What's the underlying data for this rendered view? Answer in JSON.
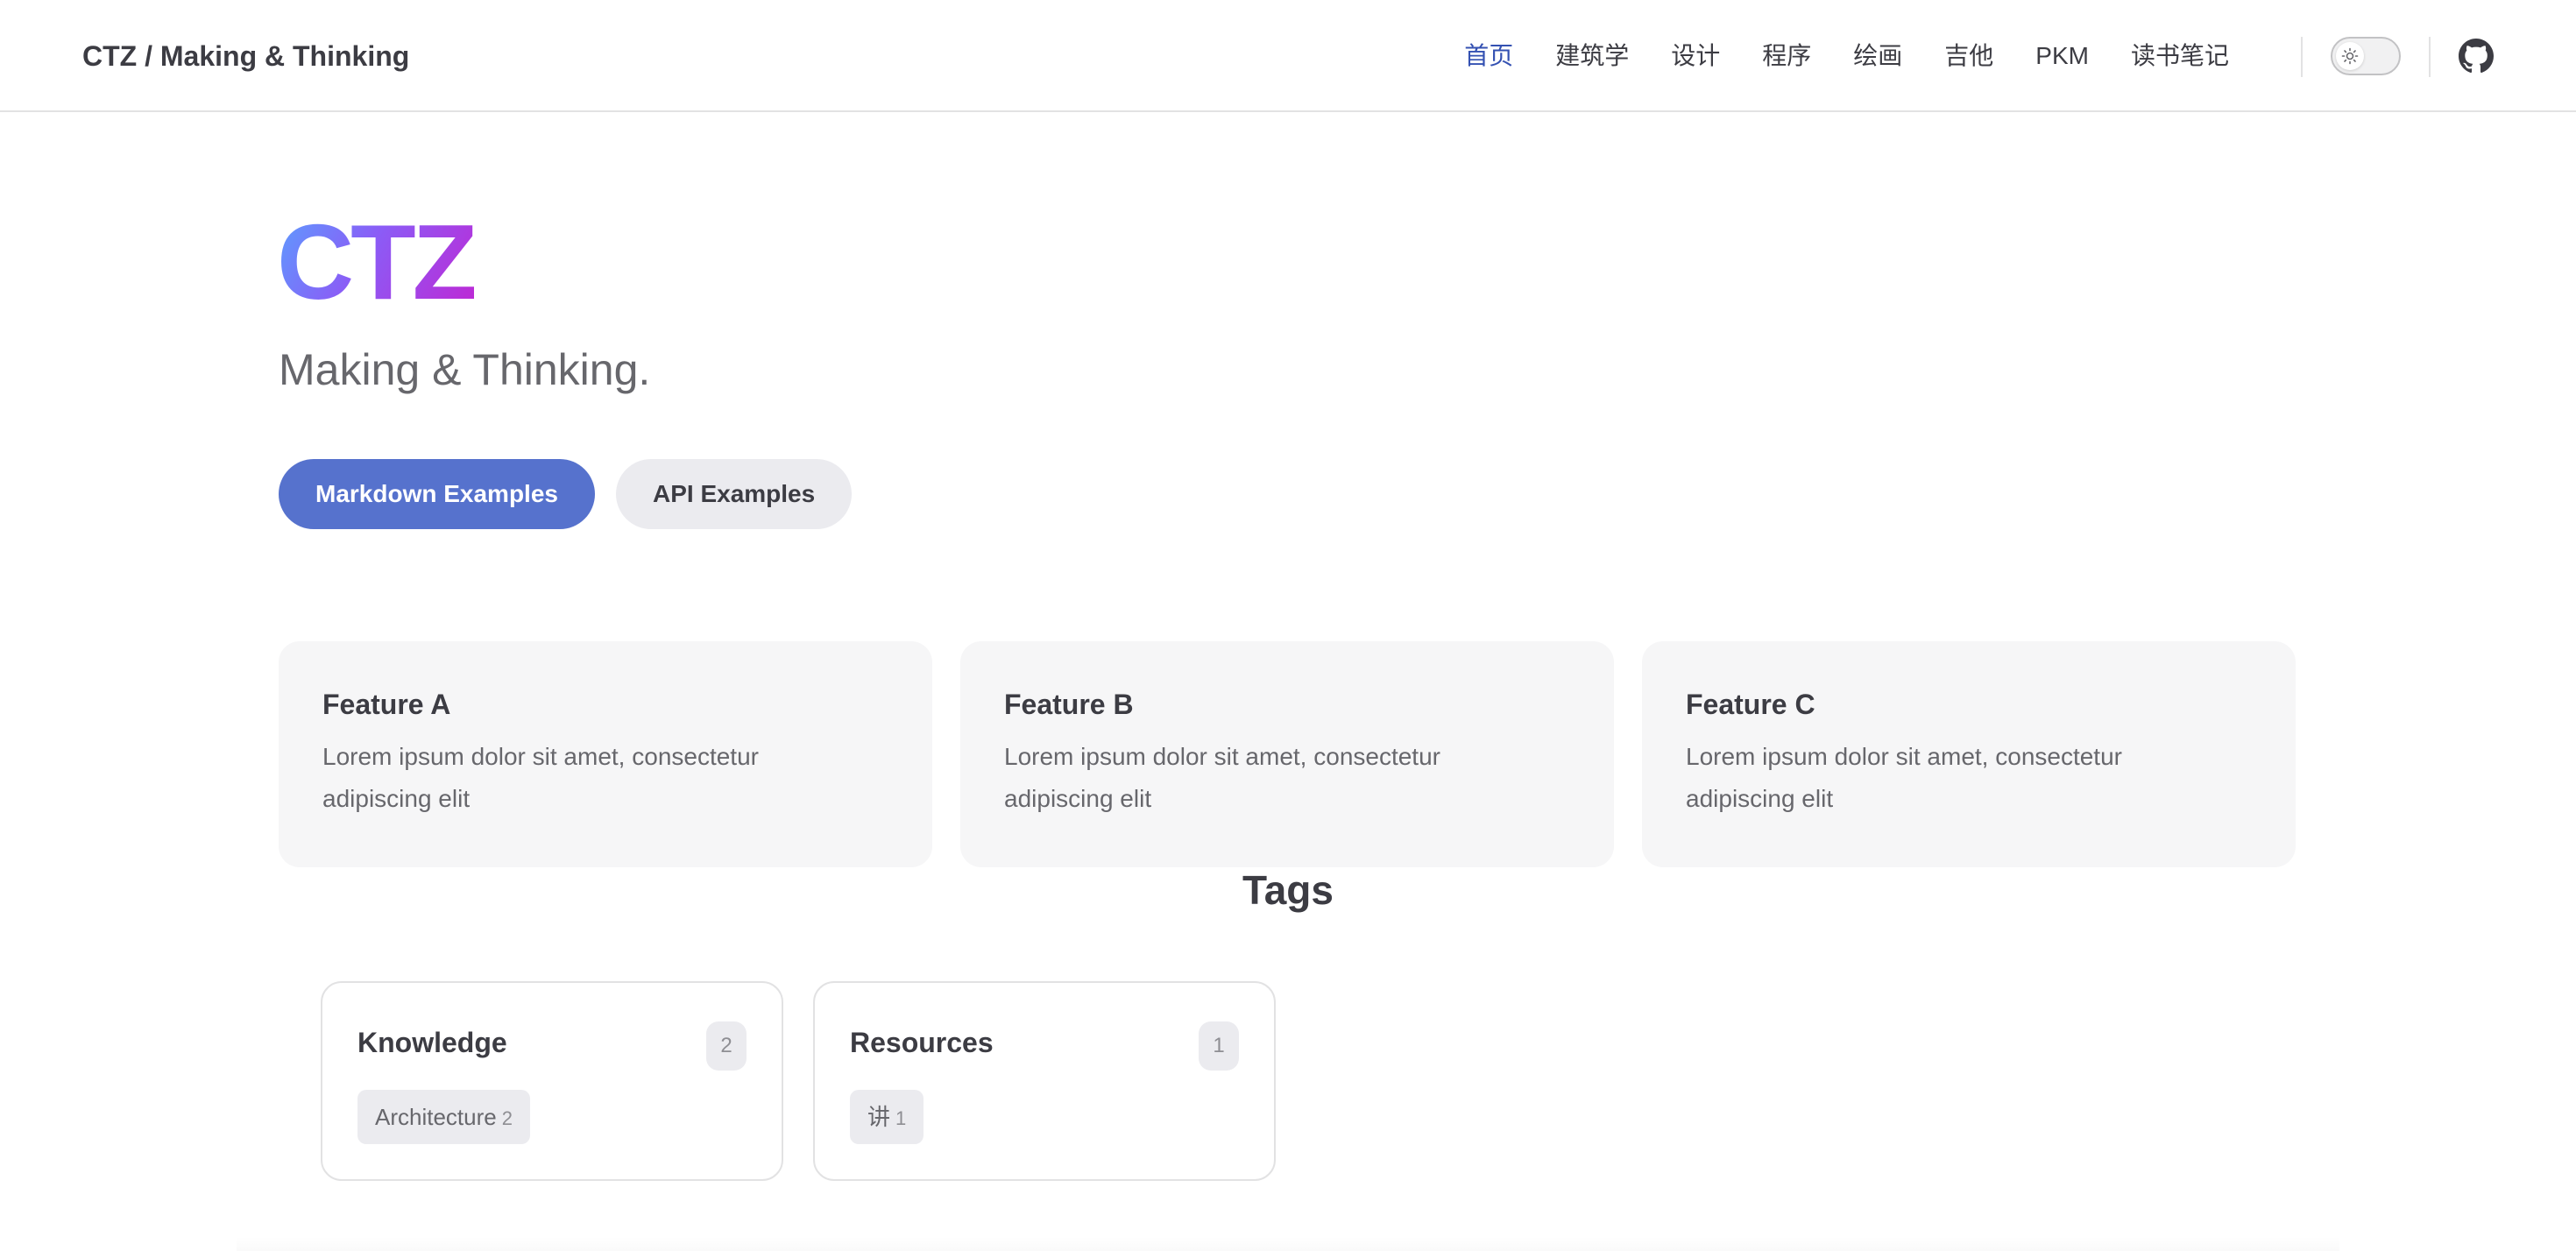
{
  "nav": {
    "site_title": "CTZ / Making & Thinking",
    "links": [
      {
        "label": "首页",
        "active": true
      },
      {
        "label": "建筑学",
        "active": false
      },
      {
        "label": "设计",
        "active": false
      },
      {
        "label": "程序",
        "active": false
      },
      {
        "label": "绘画",
        "active": false
      },
      {
        "label": "吉他",
        "active": false
      },
      {
        "label": "PKM",
        "active": false
      },
      {
        "label": "读书笔记",
        "active": false
      }
    ],
    "appearance_icon": "sun-icon",
    "github_icon": "github-icon"
  },
  "hero": {
    "name": "CTZ",
    "text": "Making & Thinking.",
    "actions": [
      {
        "label": "Markdown Examples",
        "theme": "brand"
      },
      {
        "label": "API Examples",
        "theme": "alt"
      }
    ]
  },
  "features": [
    {
      "title": "Feature A",
      "details": "Lorem ipsum dolor sit amet, consectetur adipiscing elit"
    },
    {
      "title": "Feature B",
      "details": "Lorem ipsum dolor sit amet, consectetur adipiscing elit"
    },
    {
      "title": "Feature C",
      "details": "Lorem ipsum dolor sit amet, consectetur adipiscing elit"
    }
  ],
  "tags": {
    "heading": "Tags",
    "cards": [
      {
        "title": "Knowledge",
        "count": "2",
        "chips": [
          {
            "label": "Architecture",
            "count": "2"
          }
        ]
      },
      {
        "title": "Resources",
        "count": "1",
        "chips": [
          {
            "label": "讲",
            "count": "1"
          }
        ]
      }
    ]
  },
  "colors": {
    "brand": "#5672cd",
    "active_link": "#3451b2",
    "hero_gradient": [
      "#5aa0ff",
      "#8b5cf6",
      "#c026d3"
    ]
  }
}
